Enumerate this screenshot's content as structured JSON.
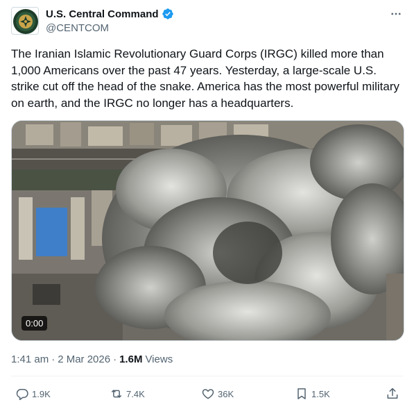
{
  "author": {
    "display_name": "U.S. Central Command",
    "handle": "@CENTCOM",
    "verified": true,
    "avatar_icon": "centcom-seal-icon"
  },
  "tweet": {
    "text": "The Iranian Islamic Revolutionary Guard Corps (IRGC) killed more than 1,000 Americans over the past 47 years. Yesterday, a large-scale U.S. strike cut off the head of the snake. America has the most powerful military on earth, and the IRGC no longer has a headquarters.",
    "video_duration": "0:00"
  },
  "meta": {
    "time": "1:41 am",
    "separator": "·",
    "date": "2 Mar 2026",
    "views_count": "1.6M",
    "views_label": "Views"
  },
  "actions": {
    "reply_count": "1.9K",
    "retweet_count": "7.4K",
    "like_count": "36K",
    "bookmark_count": "1.5K"
  },
  "colors": {
    "verified_blue": "#1d9bf0",
    "text_primary": "#0f1419",
    "text_secondary": "#536471"
  }
}
